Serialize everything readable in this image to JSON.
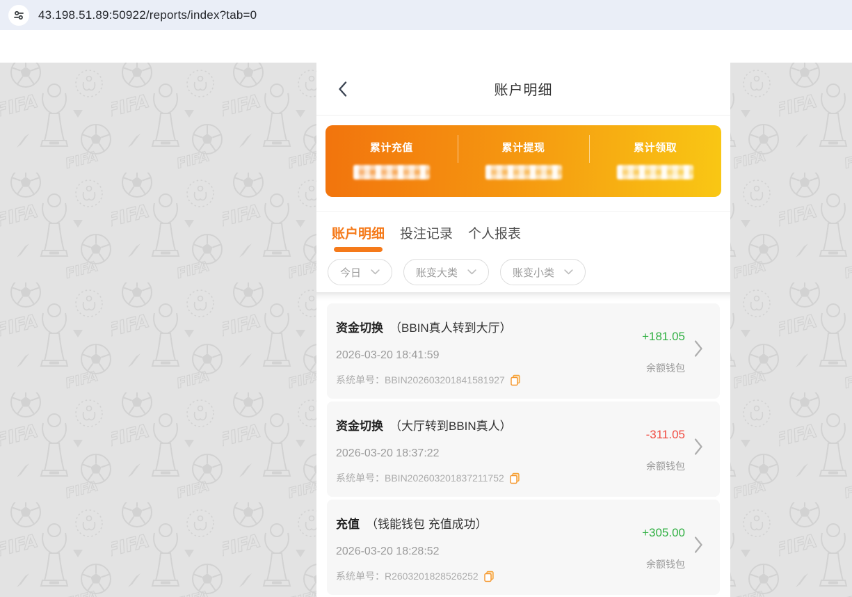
{
  "browser": {
    "url": "43.198.51.89:50922/reports/index?tab=0",
    "site_icon": "tune-controls-icon"
  },
  "page": {
    "title": "账户明细",
    "back_icon": "chevron-left"
  },
  "summary_card": {
    "items": [
      {
        "label": "累计充值",
        "value_masked": true
      },
      {
        "label": "累计提现",
        "value_masked": true
      },
      {
        "label": "累计领取",
        "value_masked": true
      }
    ]
  },
  "tabs": [
    {
      "label": "账户明细",
      "active": true
    },
    {
      "label": "投注记录",
      "active": false
    },
    {
      "label": "个人报表",
      "active": false
    }
  ],
  "filters": [
    {
      "label": "今日",
      "icon": "chevron-down-icon"
    },
    {
      "label": "账变大类",
      "icon": "chevron-down-icon"
    },
    {
      "label": "账变小类",
      "icon": "chevron-down-icon"
    }
  ],
  "transactions": [
    {
      "type": "资金切换",
      "detail": "（BBIN真人转到大厅）",
      "datetime": "2026-03-20 18:41:59",
      "order_label": "系统单号：",
      "order_no": "BBIN202603201841581927",
      "amount": "+181.05",
      "amount_color": "#31b043",
      "wallet": "余额钱包"
    },
    {
      "type": "资金切换",
      "detail": "（大厅转到BBIN真人）",
      "datetime": "2026-03-20 18:37:22",
      "order_label": "系统单号：",
      "order_no": "BBIN202603201837211752",
      "amount": "-311.05",
      "amount_color": "#f04a40",
      "wallet": "余额钱包"
    },
    {
      "type": "充值",
      "detail": "（钱能钱包 充值成功）",
      "datetime": "2026-03-20 18:28:52",
      "order_label": "系统单号：",
      "order_no": "R2603201828526252",
      "amount": "+305.00",
      "amount_color": "#31b043",
      "wallet": "余额钱包"
    }
  ],
  "colors": {
    "accent_orange": "#f57a1a",
    "gradient_start": "#f2740d",
    "gradient_end": "#f9c714",
    "positive_green": "#31b043",
    "negative_red": "#f04a40",
    "copy_icon_orange": "#f59e2f"
  },
  "background_watermarks": [
    "FIFA wordmark",
    "Club World Cup trophy",
    "soccer ball",
    "round badge",
    "triangle"
  ]
}
